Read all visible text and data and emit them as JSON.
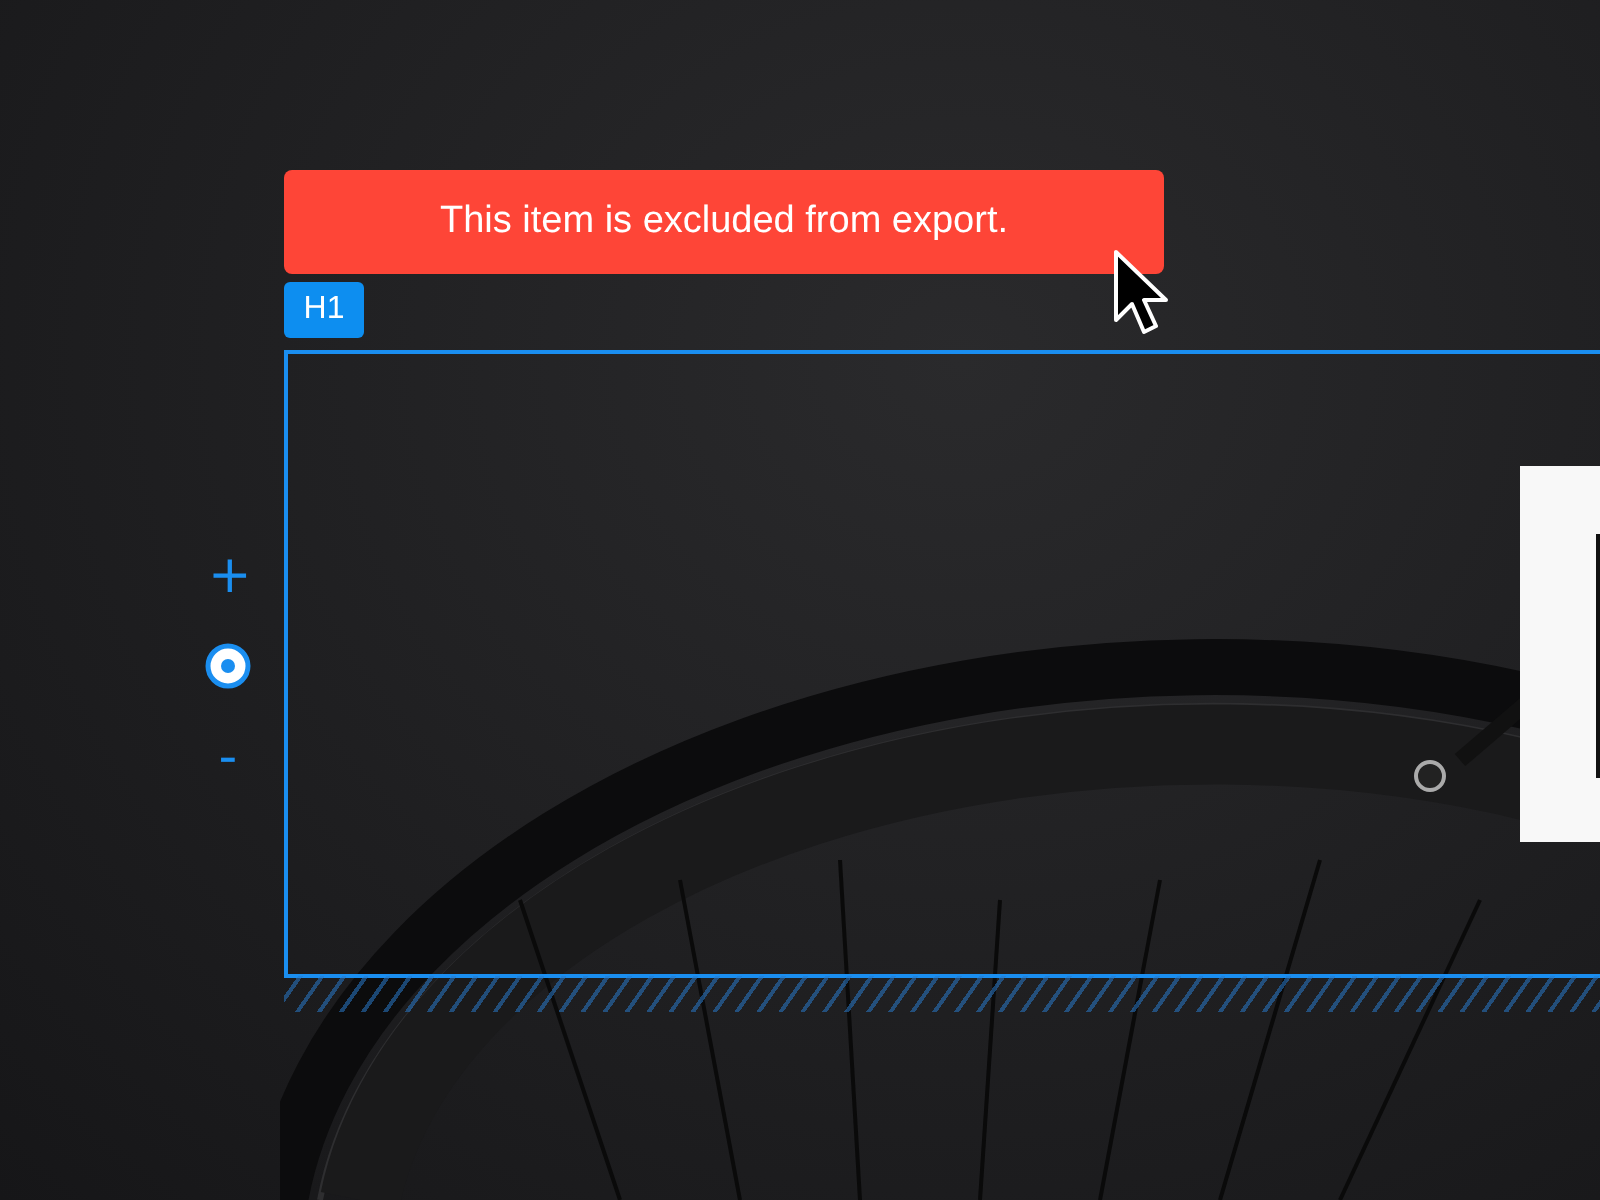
{
  "toast": {
    "text": "This item is excluded from export."
  },
  "selection": {
    "tag": "H1"
  },
  "zoom_controls": {
    "plus": "+",
    "minus": "-"
  }
}
